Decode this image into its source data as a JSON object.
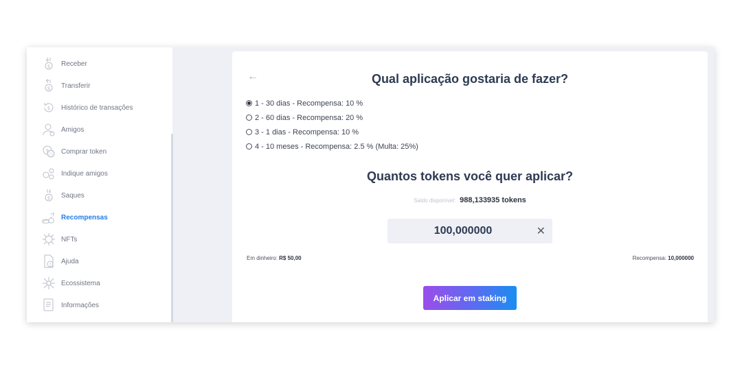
{
  "sidebar": {
    "items": [
      {
        "label": "Receber",
        "icon": "receive-coin-icon"
      },
      {
        "label": "Transferir",
        "icon": "transfer-coin-icon"
      },
      {
        "label": "Histórico de transações",
        "icon": "history-icon"
      },
      {
        "label": "Amigos",
        "icon": "friends-icon"
      },
      {
        "label": "Comprar token",
        "icon": "buy-token-icon"
      },
      {
        "label": "Indique amigos",
        "icon": "refer-friends-icon"
      },
      {
        "label": "Saques",
        "icon": "withdraw-icon"
      },
      {
        "label": "Recompensas",
        "icon": "rewards-icon",
        "active": true
      },
      {
        "label": "NFTs",
        "icon": "nft-icon"
      },
      {
        "label": "Ajuda",
        "icon": "help-icon"
      },
      {
        "label": "Ecossistema",
        "icon": "ecosystem-icon"
      },
      {
        "label": "Informações",
        "icon": "info-document-icon"
      }
    ]
  },
  "main": {
    "back_icon": "←",
    "title": "Qual aplicação gostaria de fazer?",
    "options": [
      {
        "label": "1 - 30  dias - Recompensa:  10 %",
        "selected": true
      },
      {
        "label": "2 - 60  dias - Recompensa:  20 %",
        "selected": false
      },
      {
        "label": "3 - 1  dias - Recompensa:  10 %",
        "selected": false
      },
      {
        "label": "4 - 10  meses - Recompensa:  2.5 %  (Multa: 25%)",
        "selected": false
      }
    ],
    "tokens_title": "Quantos tokens você quer aplicar?",
    "balance_label": "Saldo disponível:",
    "balance_value": "988,133935 tokens",
    "amount_value": "100,000000",
    "clear_icon": "✕",
    "cash_label": "Em dinheiro:",
    "cash_value": "R$ 50,00",
    "reward_label": "Recompensa:",
    "reward_value": "10,000000",
    "submit_label": "Aplicar em staking"
  },
  "colors": {
    "accent": "#1f7ee8",
    "button_gradient_start": "#9b4de9",
    "button_gradient_end": "#1a8ef0",
    "background": "#eef0f5"
  }
}
